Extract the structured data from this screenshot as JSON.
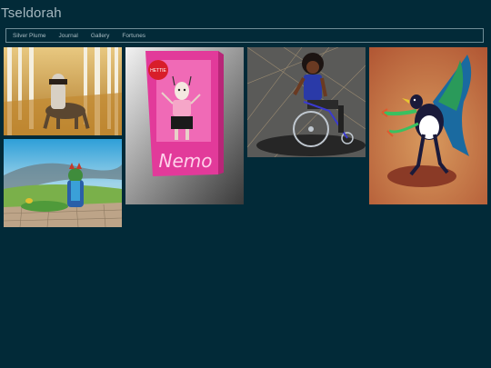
{
  "site": {
    "title": "Tseldorah"
  },
  "nav": {
    "items": [
      {
        "label": "Silver Plume"
      },
      {
        "label": "Journal"
      },
      {
        "label": "Gallery"
      },
      {
        "label": "Fortunes"
      }
    ]
  },
  "gallery": {
    "tiles": [
      {
        "subject": "centaur in birch forest"
      },
      {
        "subject": "frog-like creature on stone path under sky"
      },
      {
        "subject": "doll box figure",
        "badge_text": "HETTIE",
        "box_text": "Nemo"
      },
      {
        "subject": "person in wheelchair"
      },
      {
        "subject": "magpie bird creature"
      }
    ]
  },
  "colors": {
    "background": "#022a38",
    "text": "#a6b8c0",
    "nav_border": "#6f8d97"
  }
}
